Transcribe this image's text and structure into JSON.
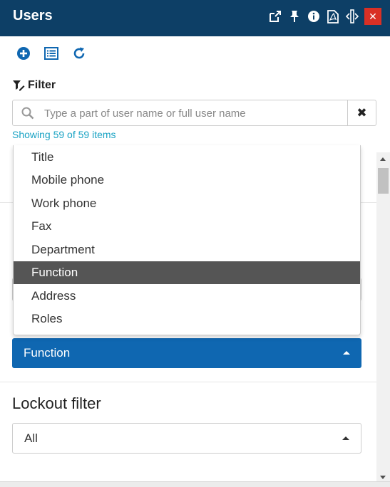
{
  "header": {
    "title": "Users",
    "icons": [
      "popout-icon",
      "pin-icon",
      "info-icon",
      "pdf-icon",
      "resize-icon",
      "close-icon"
    ],
    "close_label": "✕",
    "bg_color": "#0d3f66",
    "close_color": "#d93025"
  },
  "toolbar": {
    "icons": [
      "add-icon",
      "list-icon",
      "refresh-icon"
    ],
    "accent": "#0f67b1"
  },
  "filter": {
    "label": "Filter",
    "search_placeholder": "Type a part of user name or full user name",
    "search_value": "",
    "clear_label": "✖",
    "showing_text": "Showing 59 of 59 items",
    "showing_color": "#1aa3c4"
  },
  "dropdown": {
    "options": [
      "Title",
      "Mobile phone",
      "Work phone",
      "Fax",
      "Department",
      "Function",
      "Address",
      "Roles"
    ],
    "selected": "Function",
    "selected_bg": "#555555"
  },
  "group_select": {
    "value": "Function",
    "bg_color": "#0f67b1"
  },
  "lockout": {
    "title": "Lockout filter",
    "value": "All"
  }
}
